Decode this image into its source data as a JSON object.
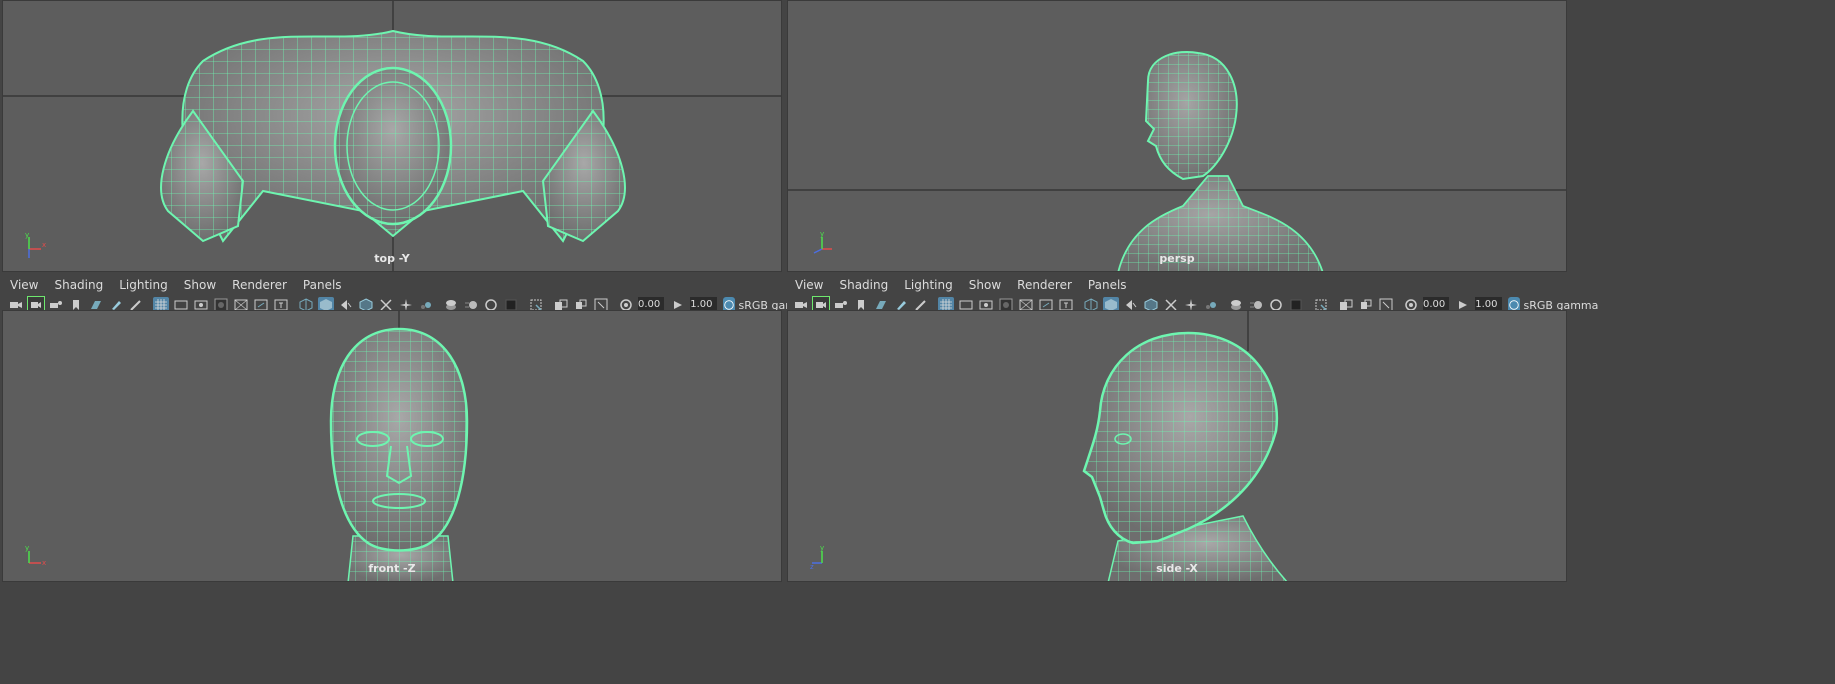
{
  "panels": [
    {
      "id": "top",
      "label": "top -Y"
    },
    {
      "id": "persp",
      "label": "persp"
    },
    {
      "id": "front",
      "label": "front -Z"
    },
    {
      "id": "side",
      "label": "side -X"
    }
  ],
  "menu": [
    "View",
    "Shading",
    "Lighting",
    "Show",
    "Renderer",
    "Panels"
  ],
  "toolbar": {
    "exposure": "0.00",
    "gamma": "1.00",
    "color_management_label": "sRGB gamma"
  },
  "icons": [
    "camera-icon",
    "camera-attributes-icon",
    "bookmark-icon",
    "image-plane-icon",
    "grease-pencil-icon",
    "grid-icon",
    "film-gate-icon",
    "resolution-gate-icon",
    "gate-mask-icon",
    "field-chart-icon",
    "safe-action-icon",
    "safe-title-icon",
    "wireframe-icon",
    "smooth-shade-icon",
    "use-default-material-icon",
    "wireframe-on-shaded-icon",
    "xray-icon",
    "xray-joints-icon",
    "default-lighting-icon",
    "shadows-icon",
    "screen-space-ao-icon",
    "motion-blur-icon",
    "anti-aliasing-icon",
    "depth-of-field-icon",
    "isolate-select-icon",
    "xray-active-icon",
    "frame-all-icon",
    "frame-selection-icon",
    "exposure-icon",
    "gamma-icon",
    "color-management-icon"
  ],
  "colors": {
    "viewport_bg": "#5d5d5d",
    "ui_bg": "#444444",
    "wireframe": "#6ef5b0",
    "active_icon": "#5285a6"
  }
}
